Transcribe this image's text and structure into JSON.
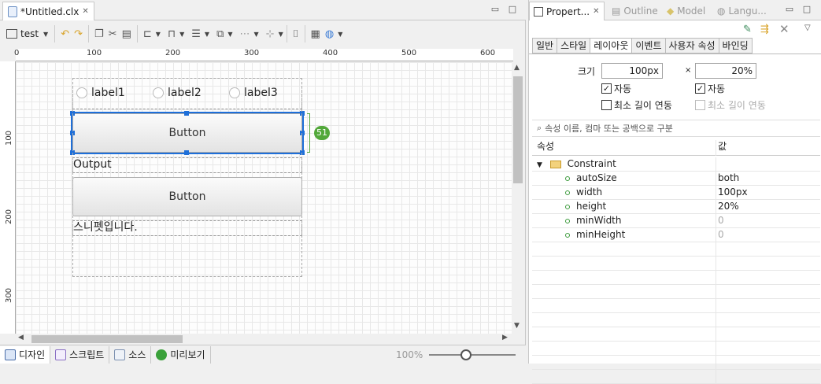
{
  "editor": {
    "tab_title": "*Untitled.clx",
    "combo_value": "test",
    "ruler_h": [
      "0",
      "100",
      "200",
      "300",
      "400",
      "500",
      "600"
    ],
    "ruler_v": [
      "100",
      "200",
      "300"
    ],
    "radios": [
      "label1",
      "label2",
      "label3"
    ],
    "button1_label": "Button",
    "badge_value": "51",
    "output_label": "Output",
    "button2_label": "Button",
    "snippet_label": "스니펫입니다.",
    "zoom": "100%",
    "bottom_tabs": [
      "디자인",
      "스크립트",
      "소스",
      "미리보기"
    ]
  },
  "props": {
    "tabs": [
      "Propert...",
      "Outline",
      "Model",
      "Langu..."
    ],
    "subtabs": [
      "일반",
      "스타일",
      "레이아웃",
      "이벤트",
      "사용자 속성",
      "바인딩"
    ],
    "size_label": "크기",
    "width_value": "100px",
    "times": "×",
    "height_value": "20%",
    "auto1": "자동",
    "auto2": "자동",
    "minlink1": "최소 길이 연동",
    "minlink2": "최소 길이 연동",
    "search_placeholder": "속성 이름, 컴마 또는 공백으로 구분",
    "col_prop": "속성",
    "col_value": "값",
    "group": "Constraint",
    "rows": [
      {
        "name": "autoSize",
        "value": "both"
      },
      {
        "name": "width",
        "value": "100px"
      },
      {
        "name": "height",
        "value": "20%"
      },
      {
        "name": "minWidth",
        "value": "0"
      },
      {
        "name": "minHeight",
        "value": "0"
      }
    ]
  },
  "colors": {
    "accent": "#1e6fd9",
    "badge": "#52a83a",
    "folder": "#e8b64c"
  }
}
